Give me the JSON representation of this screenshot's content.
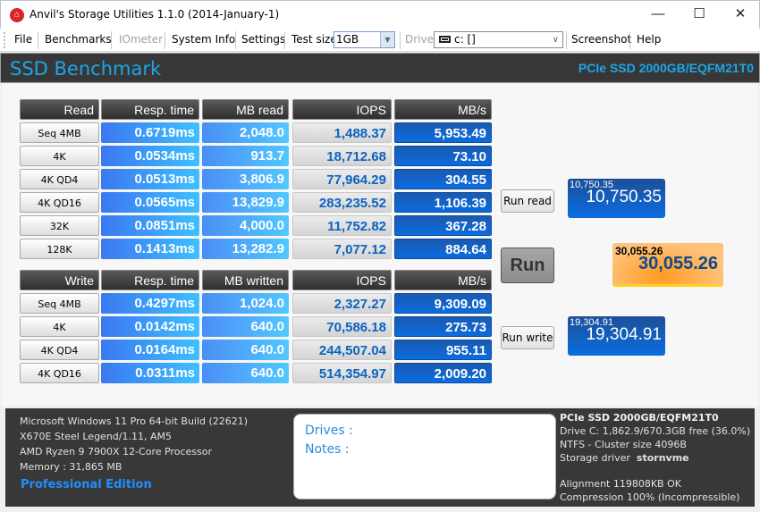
{
  "window": {
    "title": "Anvil's Storage Utilities 1.1.0 (2014-January-1)",
    "minimize": "—",
    "maximize": "☐",
    "close": "✕"
  },
  "menu": {
    "items": [
      "File",
      "Benchmarks",
      "IOmeter",
      "System Info",
      "Settings"
    ],
    "test_size_label": "Test size",
    "test_size_value": "1GB",
    "drive_label": "Drive",
    "drive_value": "c: []",
    "screenshot": "Screenshot",
    "help": "Help"
  },
  "header": {
    "title": "SSD Benchmark",
    "drive_model": "PCIe SSD 2000GB/EQFM21T0"
  },
  "read": {
    "headers": [
      "Read",
      "Resp. time",
      "MB read",
      "IOPS",
      "MB/s"
    ],
    "rows": [
      {
        "label": "Seq 4MB",
        "resp": "0.6719ms",
        "mb": "2,048.0",
        "iops": "1,488.37",
        "mbs": "5,953.49"
      },
      {
        "label": "4K",
        "resp": "0.0534ms",
        "mb": "913.7",
        "iops": "18,712.68",
        "mbs": "73.10"
      },
      {
        "label": "4K QD4",
        "resp": "0.0513ms",
        "mb": "3,806.9",
        "iops": "77,964.29",
        "mbs": "304.55"
      },
      {
        "label": "4K QD16",
        "resp": "0.0565ms",
        "mb": "13,829.9",
        "iops": "283,235.52",
        "mbs": "1,106.39"
      },
      {
        "label": "32K",
        "resp": "0.0851ms",
        "mb": "4,000.0",
        "iops": "11,752.82",
        "mbs": "367.28"
      },
      {
        "label": "128K",
        "resp": "0.1413ms",
        "mb": "13,282.9",
        "iops": "7,077.12",
        "mbs": "884.64"
      }
    ]
  },
  "write": {
    "headers": [
      "Write",
      "Resp. time",
      "MB written",
      "IOPS",
      "MB/s"
    ],
    "rows": [
      {
        "label": "Seq 4MB",
        "resp": "0.4297ms",
        "mb": "1,024.0",
        "iops": "2,327.27",
        "mbs": "9,309.09"
      },
      {
        "label": "4K",
        "resp": "0.0142ms",
        "mb": "640.0",
        "iops": "70,586.18",
        "mbs": "275.73"
      },
      {
        "label": "4K QD4",
        "resp": "0.0164ms",
        "mb": "640.0",
        "iops": "244,507.04",
        "mbs": "955.11"
      },
      {
        "label": "4K QD16",
        "resp": "0.0311ms",
        "mb": "640.0",
        "iops": "514,354.97",
        "mbs": "2,009.20"
      }
    ]
  },
  "controls": {
    "run_read": "Run read",
    "run": "Run",
    "run_write": "Run write"
  },
  "scores": {
    "read_small": "10,750.35",
    "read_big": "10,750.35",
    "total_small": "30,055.26",
    "total_big": "30,055.26",
    "write_small": "19,304.91",
    "write_big": "19,304.91"
  },
  "system": {
    "os": "Microsoft Windows 11 Pro 64-bit Build (22621)",
    "board": "X670E Steel Legend/1.11, AM5",
    "cpu": "AMD Ryzen 9 7900X 12-Core Processor",
    "memory": "Memory : 31,865 MB",
    "edition": "Professional Edition"
  },
  "notes": {
    "drives": "Drives :",
    "notes": "Notes :"
  },
  "drive_info": {
    "model": "PCIe SSD 2000GB/EQFM21T0",
    "capacity": "Drive C: 1,862.9/670.3GB free (36.0%)",
    "fs": "NTFS - Cluster size 4096B",
    "driver_label": "Storage driver",
    "driver": "stornvme",
    "alignment": "Alignment 119808KB OK",
    "compression": "Compression 100% (Incompressible)"
  }
}
